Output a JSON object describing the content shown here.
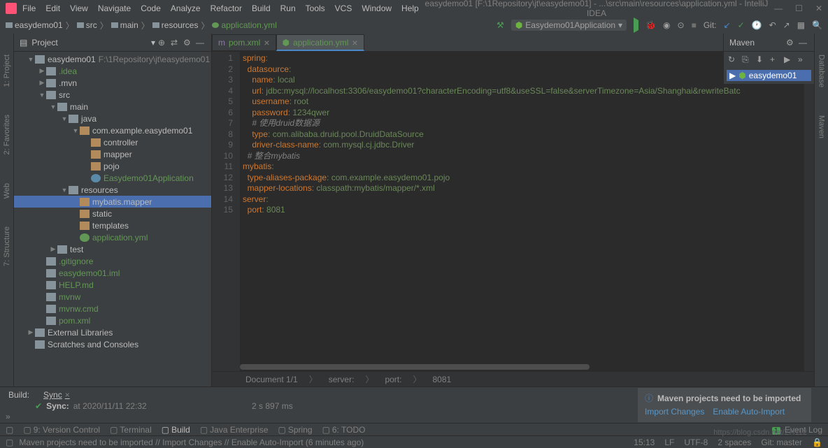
{
  "menu": [
    "File",
    "Edit",
    "View",
    "Navigate",
    "Code",
    "Analyze",
    "Refactor",
    "Build",
    "Run",
    "Tools",
    "VCS",
    "Window",
    "Help"
  ],
  "window_title": "easydemo01 [F:\\1Repository\\jt\\easydemo01] - ...\\src\\main\\resources\\application.yml - IntelliJ IDEA",
  "breadcrumbs": [
    "easydemo01",
    "src",
    "main",
    "resources",
    "application.yml"
  ],
  "run_config": "Easydemo01Application",
  "git_label": "Git:",
  "project_label": "Project",
  "left_tools": [
    "1: Project",
    "2: Favorites",
    "Web",
    "7: Structure"
  ],
  "right_tools": [
    "Database",
    "Maven"
  ],
  "tree": [
    {
      "indent": 18,
      "arrow": "▼",
      "icon": "folder",
      "label": "easydemo01",
      "path": "F:\\1Repository\\jt\\easydemo01"
    },
    {
      "indent": 34,
      "arrow": "▶",
      "icon": "folder",
      "label": ".idea",
      "class": "green"
    },
    {
      "indent": 34,
      "arrow": "▶",
      "icon": "folder",
      "label": ".mvn"
    },
    {
      "indent": 34,
      "arrow": "▼",
      "icon": "folder",
      "label": "src"
    },
    {
      "indent": 50,
      "arrow": "▼",
      "icon": "folder",
      "label": "main"
    },
    {
      "indent": 66,
      "arrow": "▼",
      "icon": "folder",
      "label": "java"
    },
    {
      "indent": 82,
      "arrow": "▼",
      "icon": "pkg",
      "label": "com.example.easydemo01"
    },
    {
      "indent": 98,
      "arrow": "",
      "icon": "pkg",
      "label": "controller"
    },
    {
      "indent": 98,
      "arrow": "",
      "icon": "pkg",
      "label": "mapper"
    },
    {
      "indent": 98,
      "arrow": "",
      "icon": "pkg",
      "label": "pojo"
    },
    {
      "indent": 98,
      "arrow": "",
      "icon": "java",
      "label": "Easydemo01Application",
      "class": "green"
    },
    {
      "indent": 66,
      "arrow": "▼",
      "icon": "folder",
      "label": "resources"
    },
    {
      "indent": 82,
      "arrow": "",
      "icon": "pkg",
      "label": "mybatis.mapper",
      "selected": true
    },
    {
      "indent": 82,
      "arrow": "",
      "icon": "pkg",
      "label": "static"
    },
    {
      "indent": 82,
      "arrow": "",
      "icon": "pkg",
      "label": "templates"
    },
    {
      "indent": 82,
      "arrow": "",
      "icon": "yml",
      "label": "application.yml",
      "class": "green"
    },
    {
      "indent": 50,
      "arrow": "▶",
      "icon": "folder",
      "label": "test"
    },
    {
      "indent": 34,
      "arrow": "",
      "icon": "file",
      "label": ".gitignore",
      "class": "green"
    },
    {
      "indent": 34,
      "arrow": "",
      "icon": "file",
      "label": "easydemo01.iml",
      "class": "green"
    },
    {
      "indent": 34,
      "arrow": "",
      "icon": "file",
      "label": "HELP.md",
      "class": "green"
    },
    {
      "indent": 34,
      "arrow": "",
      "icon": "file",
      "label": "mvnw",
      "class": "green"
    },
    {
      "indent": 34,
      "arrow": "",
      "icon": "file",
      "label": "mvnw.cmd",
      "class": "green"
    },
    {
      "indent": 34,
      "arrow": "",
      "icon": "file",
      "label": "pom.xml",
      "class": "green"
    },
    {
      "indent": 18,
      "arrow": "▶",
      "icon": "folder",
      "label": "External Libraries"
    },
    {
      "indent": 18,
      "arrow": "",
      "icon": "folder",
      "label": "Scratches and Consoles"
    }
  ],
  "tabs": [
    {
      "label": "pom.xml",
      "active": false
    },
    {
      "label": "application.yml",
      "active": true
    }
  ],
  "code_lines": [
    [
      {
        "t": "spring",
        "c": "key"
      },
      {
        "t": ":",
        "c": "val"
      }
    ],
    [
      {
        "t": "  datasource",
        "c": "key"
      },
      {
        "t": ":",
        "c": "val"
      }
    ],
    [
      {
        "t": "    name",
        "c": "key"
      },
      {
        "t": ": ",
        "c": "val"
      },
      {
        "t": "local",
        "c": "val"
      }
    ],
    [
      {
        "t": "    url",
        "c": "key"
      },
      {
        "t": ": ",
        "c": "val"
      },
      {
        "t": "jdbc:mysql://localhost:3306/easydemo01?characterEncoding=utf8&useSSL=false&serverTimezone=Asia/Shanghai&rewriteBatc",
        "c": "val"
      }
    ],
    [
      {
        "t": "    username",
        "c": "key"
      },
      {
        "t": ": ",
        "c": "val"
      },
      {
        "t": "root",
        "c": "val"
      }
    ],
    [
      {
        "t": "    password",
        "c": "key"
      },
      {
        "t": ": ",
        "c": "val"
      },
      {
        "t": "1234qwer",
        "c": "val"
      }
    ],
    [
      {
        "t": "    # 使用druid数据源",
        "c": "comment"
      }
    ],
    [
      {
        "t": "    type",
        "c": "key"
      },
      {
        "t": ": ",
        "c": "val"
      },
      {
        "t": "com.alibaba.druid.pool.DruidDataSource",
        "c": "val"
      }
    ],
    [
      {
        "t": "    driver-class-name",
        "c": "key"
      },
      {
        "t": ": ",
        "c": "val"
      },
      {
        "t": "com.mysql.cj.jdbc.Driver",
        "c": "val"
      }
    ],
    [
      {
        "t": "  # 整合mybatis",
        "c": "comment"
      }
    ],
    [
      {
        "t": "mybatis",
        "c": "key"
      },
      {
        "t": ":",
        "c": "val"
      }
    ],
    [
      {
        "t": "  type-aliases-package",
        "c": "key"
      },
      {
        "t": ": ",
        "c": "val"
      },
      {
        "t": "com.example.easydemo01.pojo",
        "c": "val"
      }
    ],
    [
      {
        "t": "  mapper-locations",
        "c": "key"
      },
      {
        "t": ": ",
        "c": "val"
      },
      {
        "t": "classpath:mybatis/mapper/*.xml",
        "c": "val"
      }
    ],
    [
      {
        "t": "server",
        "c": "key"
      },
      {
        "t": ":",
        "c": "val"
      }
    ],
    [
      {
        "t": "  port",
        "c": "key"
      },
      {
        "t": ": ",
        "c": "val"
      },
      {
        "t": "8081",
        "c": "val"
      }
    ]
  ],
  "maven_label": "Maven",
  "maven_item": "easydemo01",
  "breadcrumb_doc": [
    "Document 1/1",
    "server:",
    "port:",
    "8081"
  ],
  "build_label": "Build:",
  "sync_tab": "Sync",
  "sync_label": "Sync:",
  "sync_time": "at 2020/11/11 22:32",
  "sync_size": "2 s 897 ms",
  "notification": {
    "title": "Maven projects need to be imported",
    "link1": "Import Changes",
    "link2": "Enable Auto-Import"
  },
  "bottom_tools": [
    "9: Version Control",
    "Terminal",
    "Build",
    "Java Enterprise",
    "Spring",
    "6: TODO"
  ],
  "event_log": "Event Log",
  "event_count": "1",
  "status_message": "Maven projects need to be imported // Import Changes // Enable Auto-Import (6 minutes ago)",
  "status_right": [
    "15:13",
    "LF",
    "UTF-8",
    "2 spaces",
    "Git: master"
  ],
  "watermark": "https://blog.csdn.net/ZH112"
}
